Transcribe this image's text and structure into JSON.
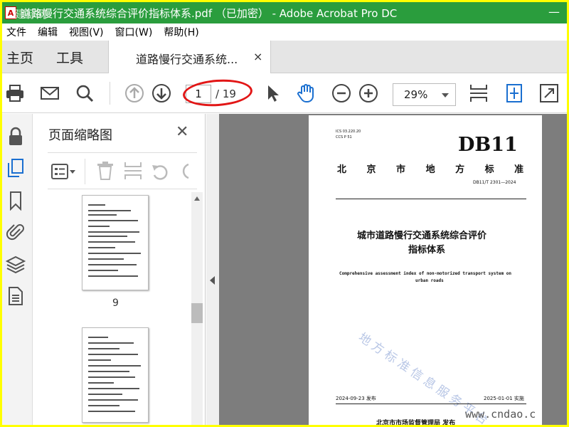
{
  "window": {
    "title": "道路慢行交通系统综合评价指标体系.pdf （已加密） - Adobe Acrobat Pro DC",
    "app_icon_text": "A",
    "minimize": "—",
    "overlay_watermark": "建标网"
  },
  "menubar": [
    "文件",
    "编辑",
    "视图(V)",
    "窗口(W)",
    "帮助(H)"
  ],
  "tabs": {
    "home": "主页",
    "tools": "工具",
    "document": "道路慢行交通系统...",
    "close": "×"
  },
  "toolbar": {
    "current_page": "1",
    "total_pages": "/ 19",
    "zoom": "29%",
    "icons": [
      "print-icon",
      "email-icon",
      "search-icon",
      "prev-page-icon",
      "next-page-icon",
      "select-cursor-icon",
      "hand-tool-icon",
      "zoom-out-icon",
      "zoom-in-icon",
      "fit-page-icon",
      "scroll-mode-icon",
      "full-screen-icon"
    ]
  },
  "rail": {
    "icons": [
      "lock-icon",
      "page-thumbnails-icon",
      "bookmark-icon",
      "attachment-icon",
      "layers-icon",
      "document-properties-icon"
    ]
  },
  "thumbnails": {
    "heading": "页面缩略图",
    "close": "✕",
    "pages": [
      {
        "number": "9"
      },
      {
        "number": ""
      }
    ]
  },
  "document": {
    "ics": "ICS  03.220.20",
    "ccs": "CCS  P 51",
    "db_code": "DB11",
    "region": "北  京  市  地  方  标  准",
    "std_number": "DB11/T 2301—2024",
    "title_line1": "城市道路慢行交通系统综合评价",
    "title_line2": "指标体系",
    "english_line1": "Comprehensive assessment index of non-motorized transport system on",
    "english_line2": "urban roads",
    "watermark": "地方标准信息服务平台",
    "issue_date": "2024-09-23 发布",
    "effective_date": "2025-01-01 实施",
    "issuer": "北京市市场监督管理局  发布",
    "site_watermark": "www.cndao.c"
  }
}
